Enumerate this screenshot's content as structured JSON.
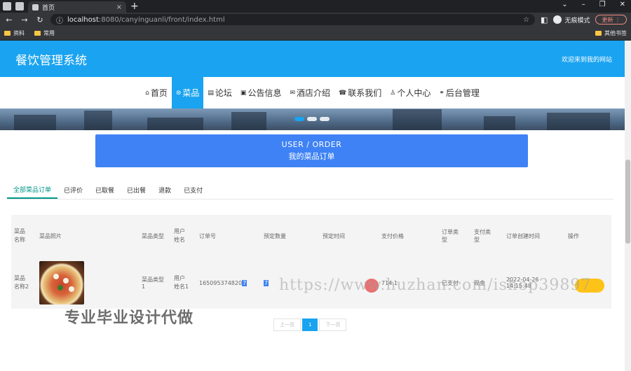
{
  "browser": {
    "tab_title": "首页",
    "url_host": "localhost",
    "url_path": ":8080/canyinguanli/front/index.html",
    "incognito_label": "无痕模式",
    "update_label": "更新",
    "bookmarks": [
      "资料",
      "常用"
    ],
    "bookmarks_right": "其他书签"
  },
  "header": {
    "title": "餐饮管理系统",
    "welcome": "欢迎来到我的网站"
  },
  "nav": [
    {
      "icon": "⌂",
      "label": "首页",
      "active": false
    },
    {
      "icon": "⊜",
      "label": "菜品",
      "active": true
    },
    {
      "icon": "▤",
      "label": "论坛",
      "active": false
    },
    {
      "icon": "▣",
      "label": "公告信息",
      "active": false
    },
    {
      "icon": "✉",
      "label": "酒店介绍",
      "active": false
    },
    {
      "icon": "☎",
      "label": "联系我们",
      "active": false
    },
    {
      "icon": "♙",
      "label": "个人中心",
      "active": false
    },
    {
      "icon": "⚭",
      "label": "后台管理",
      "active": false
    }
  ],
  "order_banner": {
    "en": "USER / ORDER",
    "cn": "我的菜品订单"
  },
  "status_tabs": [
    "全部菜品订单",
    "已评价",
    "已取餐",
    "已出餐",
    "退款",
    "已支付"
  ],
  "table": {
    "headers": [
      "菜品名称",
      "菜品照片",
      "菜品类型",
      "用户姓名",
      "订单号",
      "预定数量",
      "预定时间",
      "支付价格",
      "订单类型",
      "支付类型",
      "订单创建时间",
      "操作"
    ],
    "row": {
      "name": "菜品名称2",
      "type": "菜品类型1",
      "user": "用户姓名1",
      "order_no": "165095374820",
      "order_no_hl": "7",
      "quantity": "7",
      "price": "714.1",
      "order_type": "已支付",
      "pay_type": "现金",
      "created": "2022-04-26 14:15:48"
    }
  },
  "pager": {
    "prev": "上一页",
    "current": "1",
    "next": "下一页"
  },
  "watermark": "https://www.huzhan.com/ishop39897",
  "overlay_text": "专业毕业设计代做"
}
